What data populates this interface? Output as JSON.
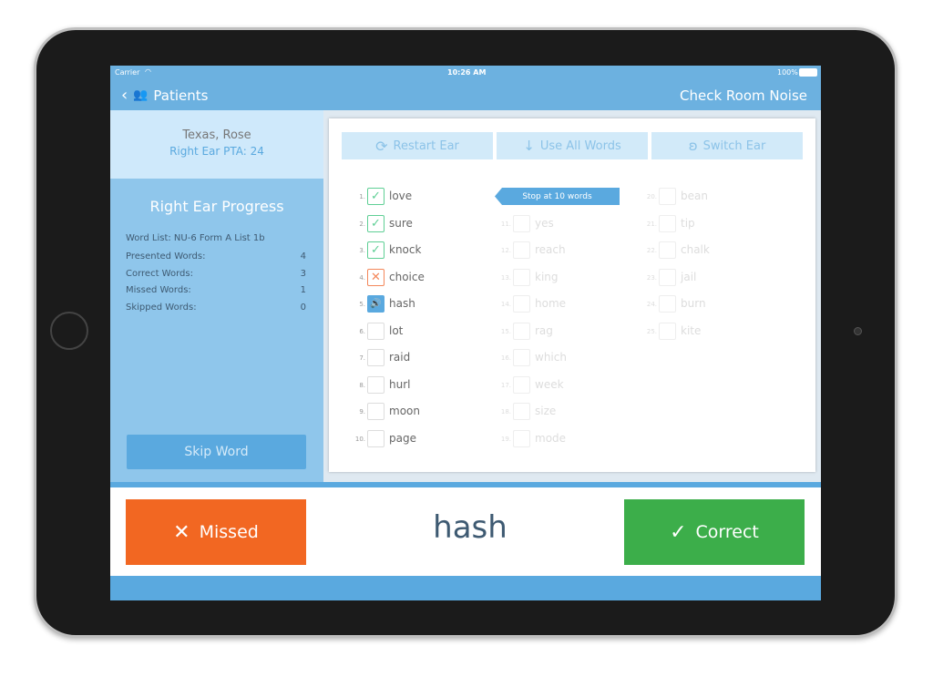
{
  "status_bar": {
    "carrier": "Carrier",
    "time": "10:26 AM",
    "battery": "100%"
  },
  "nav": {
    "back_label": "Patients",
    "right_action": "Check Room Noise"
  },
  "patient": {
    "name": "Texas, Rose",
    "pta": "Right Ear PTA: 24"
  },
  "progress": {
    "title": "Right Ear Progress",
    "word_list": "Word List: NU-6 Form A List 1b",
    "stats": [
      {
        "label": "Presented Words:",
        "value": "4"
      },
      {
        "label": "Correct Words:",
        "value": "3"
      },
      {
        "label": "Missed Words:",
        "value": "1"
      },
      {
        "label": "Skipped Words:",
        "value": "0"
      }
    ],
    "skip_label": "Skip Word"
  },
  "toolbar": {
    "restart": "Restart Ear",
    "use_all": "Use All Words",
    "switch": "Switch Ear"
  },
  "stop_label": "Stop at 10 words",
  "words": [
    {
      "n": "1.",
      "w": "love",
      "s": "correct"
    },
    {
      "n": "2.",
      "w": "sure",
      "s": "correct"
    },
    {
      "n": "3.",
      "w": "knock",
      "s": "correct"
    },
    {
      "n": "4.",
      "w": "choice",
      "s": "missed"
    },
    {
      "n": "5.",
      "w": "hash",
      "s": "current"
    },
    {
      "n": "6.",
      "w": "lot",
      "s": "pending"
    },
    {
      "n": "7.",
      "w": "raid",
      "s": "pending"
    },
    {
      "n": "8.",
      "w": "hurl",
      "s": "pending"
    },
    {
      "n": "9.",
      "w": "moon",
      "s": "pending"
    },
    {
      "n": "10.",
      "w": "page",
      "s": "pending"
    },
    {
      "n": "11.",
      "w": "yes",
      "s": "inactive"
    },
    {
      "n": "12.",
      "w": "reach",
      "s": "inactive"
    },
    {
      "n": "13.",
      "w": "king",
      "s": "inactive"
    },
    {
      "n": "14.",
      "w": "home",
      "s": "inactive"
    },
    {
      "n": "15.",
      "w": "rag",
      "s": "inactive"
    },
    {
      "n": "16.",
      "w": "which",
      "s": "inactive"
    },
    {
      "n": "17.",
      "w": "week",
      "s": "inactive"
    },
    {
      "n": "18.",
      "w": "size",
      "s": "inactive"
    },
    {
      "n": "19.",
      "w": "mode",
      "s": "inactive"
    },
    {
      "n": "20.",
      "w": "bean",
      "s": "inactive"
    },
    {
      "n": "21.",
      "w": "tip",
      "s": "inactive"
    },
    {
      "n": "22.",
      "w": "chalk",
      "s": "inactive"
    },
    {
      "n": "23.",
      "w": "jail",
      "s": "inactive"
    },
    {
      "n": "24.",
      "w": "burn",
      "s": "inactive"
    },
    {
      "n": "25.",
      "w": "kite",
      "s": "inactive"
    }
  ],
  "current_word": "hash",
  "actions": {
    "missed": "Missed",
    "correct": "Correct"
  },
  "colors": {
    "header": "#6cb1e0",
    "correct": "#3cae4a",
    "missed": "#f26722",
    "check": "#5fcf95",
    "cross": "#f4875a",
    "current": "#5aa9df"
  }
}
